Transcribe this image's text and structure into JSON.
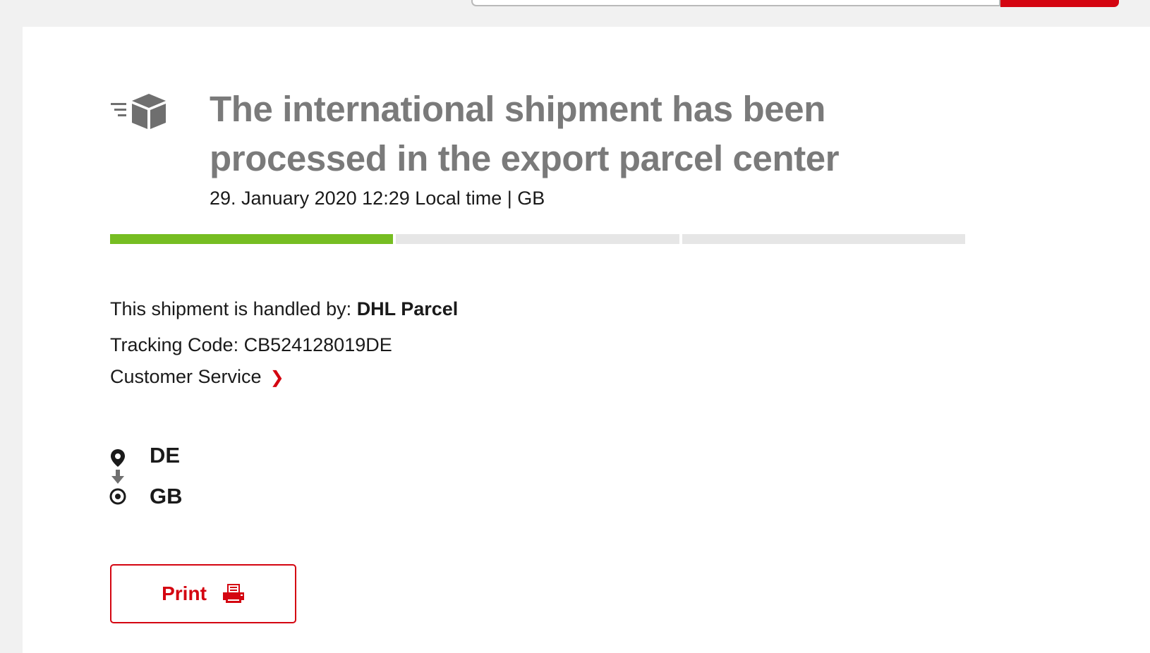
{
  "brand": {
    "accent": "#d40511",
    "progress_done": "#76bd22",
    "progress_pending": "#e6e6e6"
  },
  "status": {
    "icon": "parcel-box-icon",
    "headline": "The international shipment has been processed in the export parcel center",
    "timestamp": "29. January 2020 12:29 Local time | GB",
    "progress": {
      "steps": 3,
      "completed": 1
    }
  },
  "details": {
    "handled_by_label": "This shipment is handled by: ",
    "handled_by_value": "DHL Parcel",
    "tracking_code": "Tracking Code: CB524128019DE",
    "customer_service": "Customer Service"
  },
  "route": {
    "origin_icon": "location-pin-icon",
    "direction_icon": "arrow-down-icon",
    "destination_icon": "target-icon",
    "from": "DE",
    "to": "GB"
  },
  "actions": {
    "print_label": "Print",
    "print_icon": "printer-icon"
  }
}
